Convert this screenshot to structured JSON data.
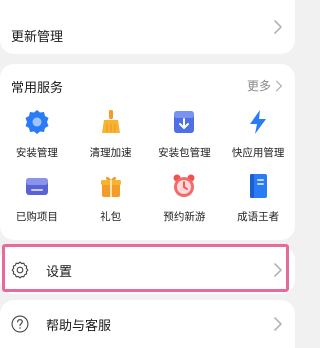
{
  "update": {
    "title": "更新管理"
  },
  "services": {
    "title": "常用服务",
    "more": "更多",
    "items": [
      {
        "label": "安装管理",
        "icon": "gear-badge-icon"
      },
      {
        "label": "清理加速",
        "icon": "broom-icon"
      },
      {
        "label": "安装包管理",
        "icon": "package-box-icon"
      },
      {
        "label": "快应用管理",
        "icon": "lightning-icon"
      },
      {
        "label": "已购项目",
        "icon": "purchased-wallet-icon"
      },
      {
        "label": "礼包",
        "icon": "gift-icon"
      },
      {
        "label": "预约新游",
        "icon": "alarm-clock-icon"
      },
      {
        "label": "成语王者",
        "icon": "book-icon"
      }
    ]
  },
  "settings": {
    "label": "设置"
  },
  "help": {
    "label": "帮助与客服"
  },
  "colors": {
    "highlight": "#e8699c",
    "blue": "#2a7bf6",
    "orange": "#f59b28",
    "red": "#f24f4f"
  }
}
